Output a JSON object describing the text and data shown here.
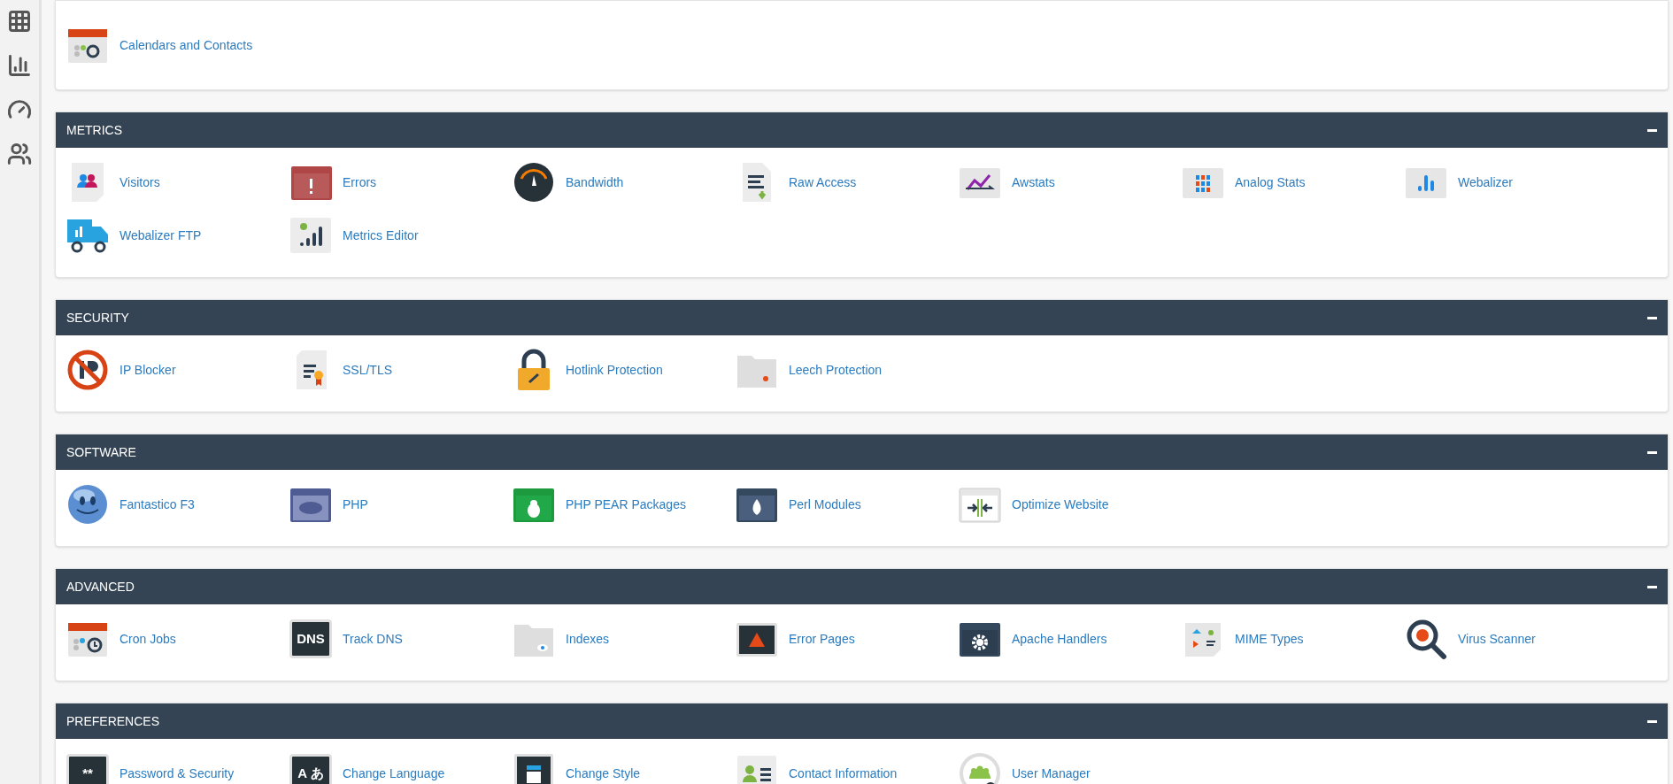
{
  "sidebar": {
    "items": [
      {
        "kind": "grid"
      },
      {
        "kind": "chart"
      },
      {
        "kind": "gauge"
      },
      {
        "kind": "users"
      }
    ]
  },
  "sections": [
    {
      "items": [
        {
          "label": "Calendars and Contacts",
          "kind": "calendar"
        }
      ]
    },
    {
      "title": "METRICS",
      "items": [
        {
          "label": "Visitors",
          "kind": "visitors"
        },
        {
          "label": "Errors",
          "kind": "errors"
        },
        {
          "label": "Bandwidth",
          "kind": "bandwidth"
        },
        {
          "label": "Raw Access",
          "kind": "rawaccess"
        },
        {
          "label": "Awstats",
          "kind": "awstats"
        },
        {
          "label": "Analog Stats",
          "kind": "analog"
        },
        {
          "label": "Webalizer",
          "kind": "webalizer"
        },
        {
          "label": "Webalizer FTP",
          "kind": "truck"
        },
        {
          "label": "Metrics Editor",
          "kind": "metricseditor"
        }
      ]
    },
    {
      "title": "SECURITY",
      "items": [
        {
          "label": "IP Blocker",
          "kind": "ipblocker"
        },
        {
          "label": "SSL/TLS",
          "kind": "ssl"
        },
        {
          "label": "Hotlink Protection",
          "kind": "padlock"
        },
        {
          "label": "Leech Protection",
          "kind": "leech"
        }
      ]
    },
    {
      "title": "SOFTWARE",
      "items": [
        {
          "label": "Fantastico F3",
          "kind": "sphere"
        },
        {
          "label": "PHP",
          "kind": "php"
        },
        {
          "label": "PHP PEAR Packages",
          "kind": "pear"
        },
        {
          "label": "Perl Modules",
          "kind": "perl"
        },
        {
          "label": "Optimize Website",
          "kind": "optimize"
        }
      ]
    },
    {
      "title": "ADVANCED",
      "items": [
        {
          "label": "Cron Jobs",
          "kind": "cron"
        },
        {
          "label": "Track DNS",
          "kind": "tile",
          "icon_text": "DNS"
        },
        {
          "label": "Indexes",
          "kind": "indexes"
        },
        {
          "label": "Error Pages",
          "kind": "errorpages"
        },
        {
          "label": "Apache Handlers",
          "kind": "handlers"
        },
        {
          "label": "MIME Types",
          "kind": "mime"
        },
        {
          "label": "Virus Scanner",
          "kind": "virus"
        }
      ]
    },
    {
      "title": "PREFERENCES",
      "items": [
        {
          "label": "Password & Security",
          "kind": "tile",
          "icon_text": "**"
        },
        {
          "label": "Change Language",
          "kind": "tile",
          "icon_text": "A あ"
        },
        {
          "label": "Change Style",
          "kind": "style"
        },
        {
          "label": "Contact Information",
          "kind": "contact"
        },
        {
          "label": "User Manager",
          "kind": "usermanager"
        }
      ]
    }
  ]
}
